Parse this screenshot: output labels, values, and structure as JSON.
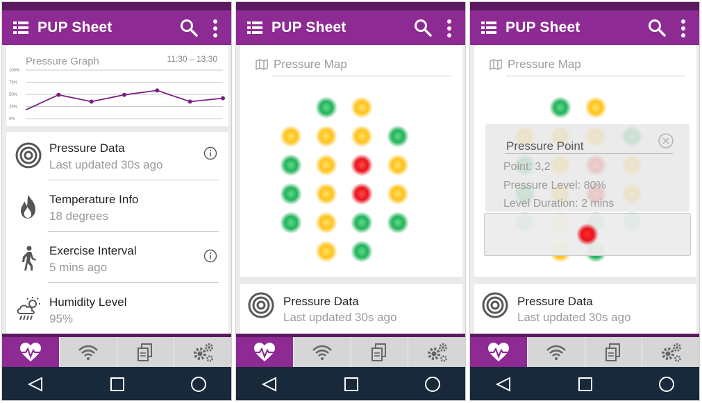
{
  "app": {
    "title": "PUP Sheet"
  },
  "colors": {
    "brand": "#8e2a94",
    "brand_dark": "#5b1a60",
    "nav": "#17293a",
    "green": "#22b35a",
    "yellow": "#ffc21a",
    "red": "#e8141e"
  },
  "graph": {
    "title": "Pressure Graph",
    "time_range": "11:30 – 13:30",
    "y_ticks": [
      "100%",
      "75%",
      "50%",
      "25%",
      "0%"
    ],
    "values": [
      18,
      49,
      35,
      49,
      58,
      35,
      42
    ]
  },
  "list": [
    {
      "title": "Pressure Data",
      "subtitle": "Last updated 30s ago",
      "icon": "target-icon",
      "has_info": true
    },
    {
      "title": "Temperature Info",
      "subtitle": "18 degrees",
      "icon": "flame-icon",
      "has_info": false
    },
    {
      "title": "Exercise Interval",
      "subtitle": "5 mins ago",
      "icon": "walking-icon",
      "has_info": true
    },
    {
      "title": "Humidity Level",
      "subtitle": "95%",
      "icon": "weather-icon",
      "has_info": false
    }
  ],
  "map": {
    "title": "Pressure Map",
    "grid": [
      [
        "",
        "green",
        "yellow",
        ""
      ],
      [
        "yellow",
        "yellow",
        "yellow",
        "green"
      ],
      [
        "green",
        "yellow",
        "red",
        "yellow"
      ],
      [
        "green",
        "yellow",
        "red",
        "yellow"
      ],
      [
        "green",
        "yellow",
        "green",
        "green"
      ],
      [
        "",
        "yellow",
        "green",
        ""
      ]
    ]
  },
  "bottom_card": {
    "title": "Pressure Data",
    "subtitle": "Last updated 30s ago"
  },
  "popup": {
    "title": "Pressure Point",
    "point": "Point: 3,2",
    "level": "Pressure Level: 80%",
    "duration": "Level Duration: 2 mins"
  },
  "tabs": [
    "heart-pulse-icon",
    "wifi-icon",
    "copy-icon",
    "gears-icon"
  ],
  "nav": [
    "back-icon",
    "home-icon",
    "recents-icon"
  ]
}
